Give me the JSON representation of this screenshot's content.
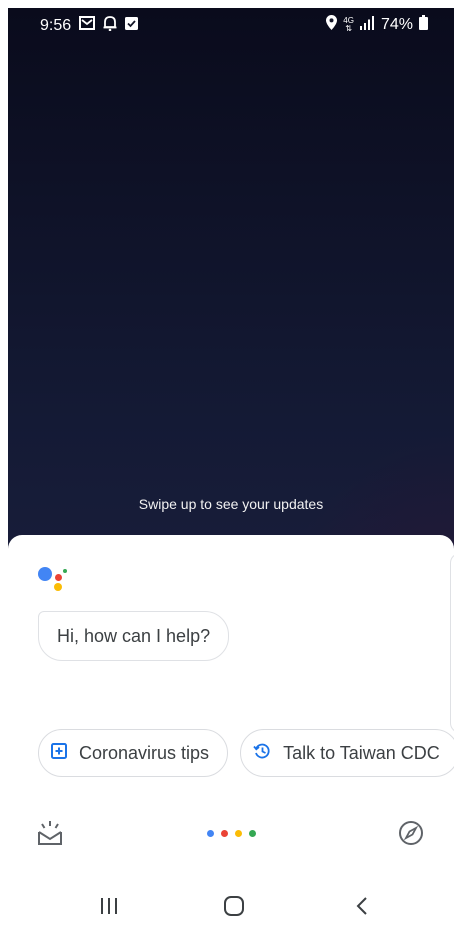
{
  "status_bar": {
    "time": "9:56",
    "network_type": "4G",
    "battery": "74%",
    "icons": [
      "gmail-icon",
      "notification-bell-icon",
      "checkbox-icon",
      "location-icon",
      "signal-icon",
      "battery-icon"
    ]
  },
  "swipe_hint": "Swipe up to see your updates",
  "assistant": {
    "greeting": "Hi, how can I help?",
    "logo_colors": [
      "#4285F4",
      "#EA4335",
      "#FBBC05",
      "#34A853"
    ],
    "suggestions": [
      {
        "label": "Coronavirus tips",
        "icon": "plus-box-icon",
        "icon_color": "#1a73e8"
      },
      {
        "label": "Talk to Taiwan CDC",
        "icon": "history-icon",
        "icon_color": "#1a73e8"
      }
    ],
    "bottom_icons": [
      "updates-icon",
      "assistant-dots",
      "explore-compass-icon"
    ]
  },
  "navigation": {
    "buttons": [
      "recents-button",
      "home-button",
      "back-button"
    ]
  }
}
